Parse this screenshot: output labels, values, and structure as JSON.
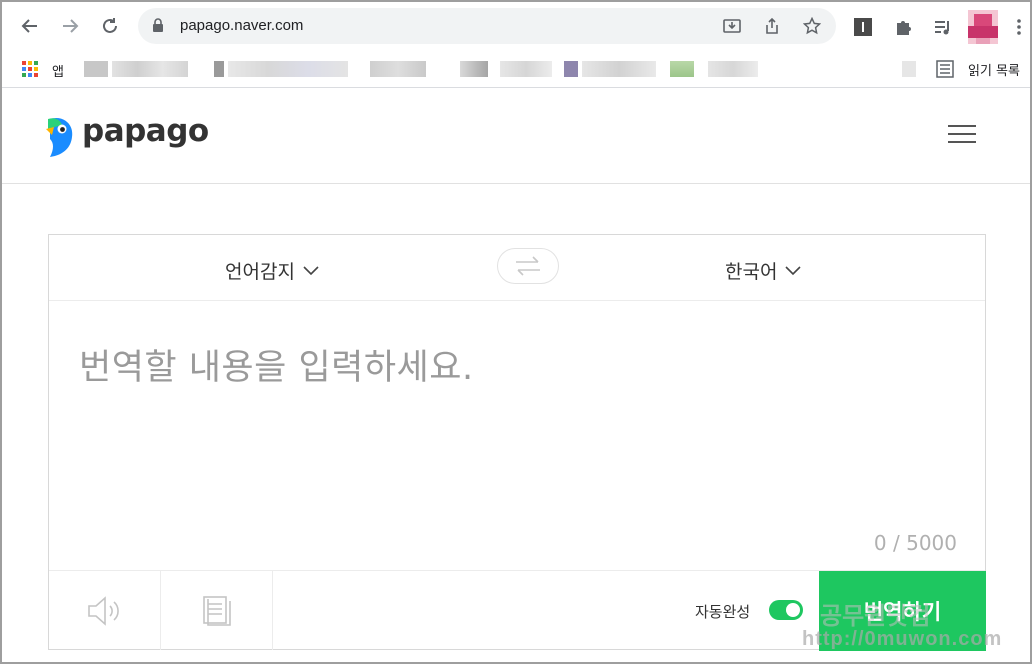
{
  "browser": {
    "url": "papago.naver.com",
    "bookmarks": {
      "apps_label": "앱",
      "reading_list_label": "읽기 목록"
    }
  },
  "app": {
    "logo_text": "papago"
  },
  "translator": {
    "source_language": "언어감지",
    "target_language": "한국어",
    "input_placeholder": "번역할 내용을 입력하세요.",
    "char_counter": "0 / 5000",
    "autocomplete_label": "자동완성",
    "autocomplete_on": true,
    "translate_label": "번역하기"
  },
  "watermark": {
    "line1": "공무원닷컴",
    "line2": "http://0muwon.com"
  },
  "colors": {
    "accent_green": "#1ec760",
    "logo_blue": "#1a8cff"
  }
}
